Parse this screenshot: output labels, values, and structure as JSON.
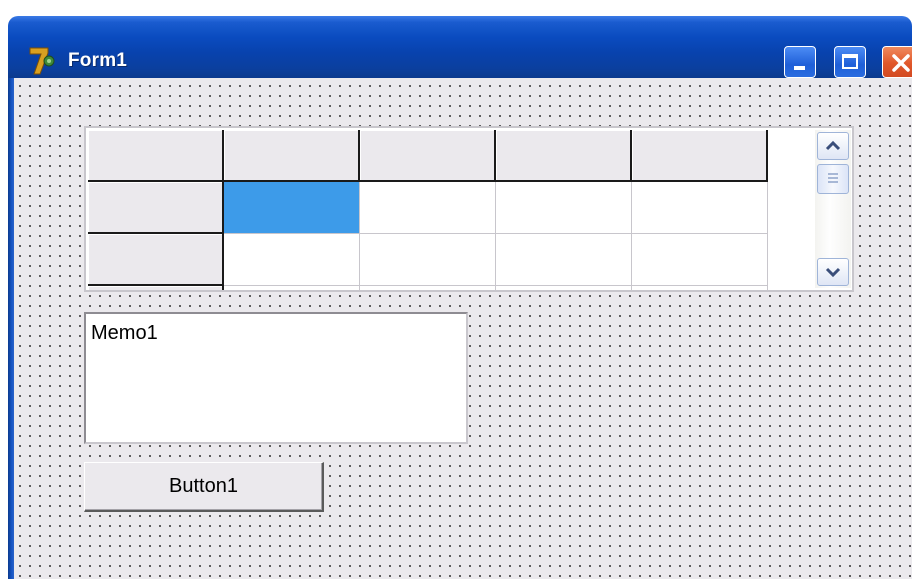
{
  "window": {
    "title": "Form1",
    "icon": "delphi-logo-icon",
    "controls": [
      "minimize-icon",
      "maximize-icon",
      "close-icon"
    ]
  },
  "grid": {
    "name": "StringGrid",
    "columns": 5,
    "visible_rows": 3,
    "fixed_rows": 1,
    "fixed_cols": 1,
    "cells": [
      [
        "",
        "",
        "",
        "",
        ""
      ],
      [
        "",
        "",
        "",
        "",
        ""
      ],
      [
        "",
        "",
        "",
        "",
        ""
      ]
    ],
    "selected_cell": {
      "row": 1,
      "col": 1
    },
    "selected_color": "#3d9be9"
  },
  "memo": {
    "text": "Memo1"
  },
  "button": {
    "label": "Button1"
  },
  "colors": {
    "titlebar": "#0a4bbf",
    "form_background": "#ebe9ed",
    "close_button": "#e0572a"
  }
}
